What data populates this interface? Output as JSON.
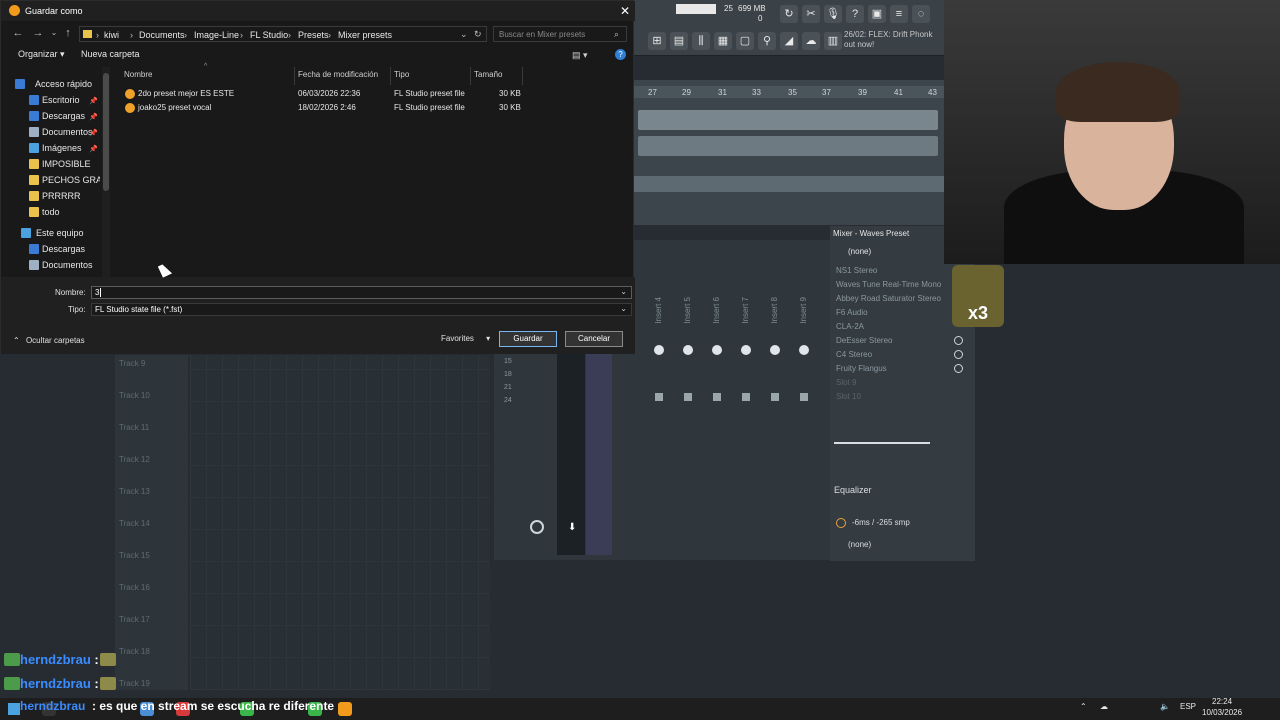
{
  "dialog": {
    "title": "Guardar como",
    "close_glyph": "✕",
    "nav": {
      "back": "←",
      "forward": "→",
      "dropdown": "⌄",
      "up": "↑"
    },
    "breadcrumbs": [
      "kiwi",
      "Documents",
      "Image-Line",
      "FL Studio",
      "Presets",
      "Mixer presets"
    ],
    "search_placeholder": "Buscar en Mixer presets",
    "command_bar": {
      "organize": "Organizar",
      "new_folder": "Nueva carpeta"
    },
    "nav_pane": {
      "quick_access": "Acceso rápido",
      "items": [
        {
          "label": "Escritorio",
          "icon": "desktop-icon",
          "color": "#3a7bd5",
          "pinned": true
        },
        {
          "label": "Descargas",
          "icon": "download-icon",
          "color": "#3a7bd5",
          "pinned": true
        },
        {
          "label": "Documentos",
          "icon": "documents-icon",
          "color": "#9fb0c4",
          "pinned": true
        },
        {
          "label": "Imágenes",
          "icon": "pictures-icon",
          "color": "#4aa3df",
          "pinned": true
        },
        {
          "label": "IMPOSIBLE",
          "icon": "folder-icon",
          "color": "#e8c24a",
          "pinned": false
        },
        {
          "label": "PECHOS GRANDES",
          "icon": "folder-icon",
          "color": "#e8c24a",
          "pinned": false
        },
        {
          "label": "PRRRRR",
          "icon": "folder-icon",
          "color": "#e8c24a",
          "pinned": false
        },
        {
          "label": "todo",
          "icon": "folder-icon",
          "color": "#e8c24a",
          "pinned": false
        }
      ],
      "this_pc": "Este equipo",
      "pc_items": [
        {
          "label": "Descargas",
          "icon": "download-icon",
          "color": "#3a7bd5"
        },
        {
          "label": "Documentos",
          "icon": "documents-icon",
          "color": "#9fb0c4"
        }
      ]
    },
    "columns": [
      "Nombre",
      "Fecha de modificación",
      "Tipo",
      "Tamaño"
    ],
    "files": [
      {
        "name": "2do preset mejor ES ESTE",
        "date": "06/03/2026 22:36",
        "type": "FL Studio preset file",
        "size": "30 KB"
      },
      {
        "name": "joako25 preset vocal",
        "date": "18/02/2026 2:46",
        "type": "FL Studio preset file",
        "size": "30 KB"
      }
    ],
    "form": {
      "name_label": "Nombre:",
      "name_value": "3",
      "type_label": "Tipo:",
      "type_value": "FL Studio state file (*.fst)"
    },
    "hide_folders": "Ocultar carpetas",
    "favorites": "Favorites",
    "save": "Guardar",
    "cancel": "Cancelar"
  },
  "fl": {
    "toolbar": {
      "memory": "699 MB",
      "cpu_top": "25",
      "cpu_bottom": "0",
      "news_line1": "26/02: FLEX: Drift Phonk",
      "news_line2": "out now!"
    },
    "ruler_ticks": [
      "27",
      "29",
      "31",
      "33",
      "35",
      "37",
      "39",
      "41",
      "43"
    ],
    "mixer_title": "Mixer - Waves Preset",
    "preset_none": "(none)",
    "slots": [
      "NS1 Stereo",
      "Waves Tune Real-Time Mono",
      "Abbey Road Saturator Stereo",
      "F6 Audio",
      "CLA-2A",
      "DeEsser Stereo",
      "C4 Stereo",
      "Fruity Flangus",
      "Slot 9",
      "Slot 10"
    ],
    "inserts": [
      "Insert 4",
      "Insert 5",
      "Insert 6",
      "Insert 7",
      "Insert 8",
      "Insert 9"
    ],
    "equalizer": "Equalizer",
    "latency": "-6ms / -265 smp",
    "bottom_none": "(none)",
    "tracks": [
      "Track 9",
      "Track 10",
      "Track 11",
      "Track 12",
      "Track 13",
      "Track 14",
      "Track 15",
      "Track 16",
      "Track 17",
      "Track 18",
      "Track 19"
    ],
    "meter_marks": [
      "15",
      "18",
      "21",
      "24"
    ]
  },
  "stream": {
    "chat": [
      {
        "user": "herndzbrau",
        "sep": ":"
      },
      {
        "user": "herndzbrau",
        "sep": ":"
      }
    ],
    "bottom_user": "herndzbrau",
    "message": ": es que en stream se escucha re diferente",
    "sticker_text": "x3"
  },
  "taskbar": {
    "lang": "ESP",
    "time": "22:24",
    "date": "10/03/2026"
  }
}
